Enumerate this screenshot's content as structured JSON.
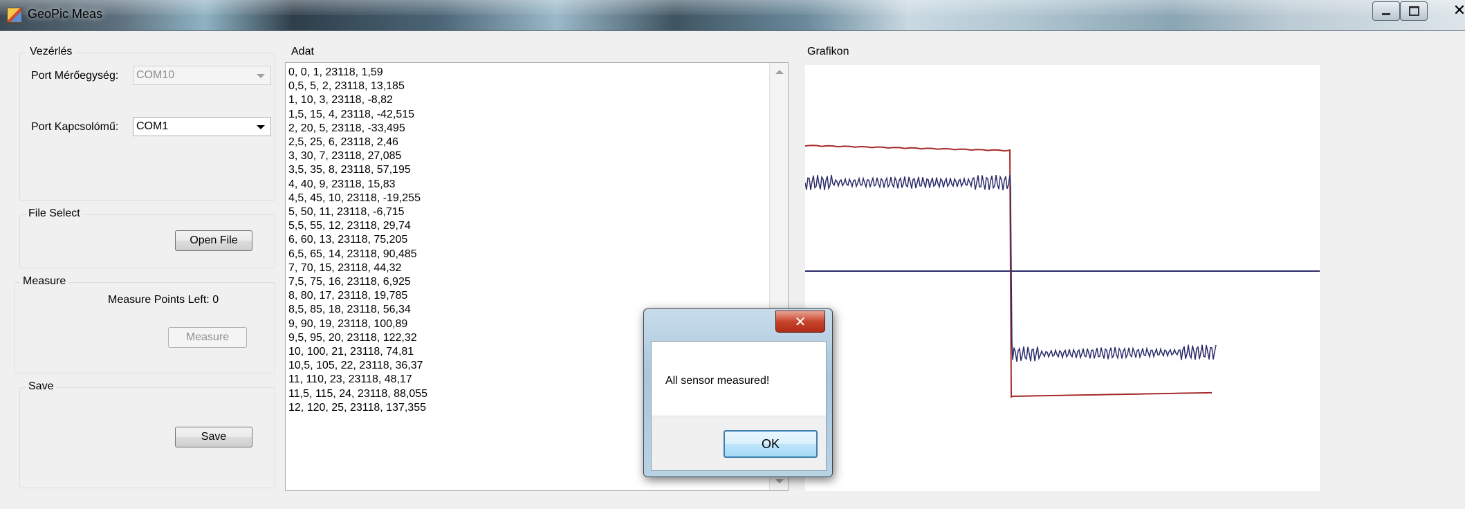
{
  "window": {
    "title": "GeoPic Meas"
  },
  "controls": {
    "title": "Vezérlés",
    "port_meter_label": "Port Mérőegység:",
    "port_meter_value": "COM10",
    "port_switch_label": "Port Kapcsolómű:",
    "port_switch_value": "COM1"
  },
  "file_select": {
    "title": "File Select",
    "open_label": "Open File"
  },
  "measure": {
    "title": "Measure",
    "points_left": "Measure Points Left: 0",
    "button_label": "Measure"
  },
  "save": {
    "title": "Save",
    "button_label": "Save"
  },
  "data": {
    "title": "Adat",
    "lines": [
      "0, 0, 1, 23118, 1,59",
      "0,5, 5, 2, 23118, 13,185",
      "1, 10, 3, 23118, -8,82",
      "1,5, 15, 4, 23118, -42,515",
      "2, 20, 5, 23118, -33,495",
      "2,5, 25, 6, 23118, 2,46",
      "3, 30, 7, 23118, 27,085",
      "3,5, 35, 8, 23118, 57,195",
      "4, 40, 9, 23118, 15,83",
      "4,5, 45, 10, 23118, -19,255",
      "5, 50, 11, 23118, -6,715",
      "5,5, 55, 12, 23118, 29,74",
      "6, 60, 13, 23118, 75,205",
      "6,5, 65, 14, 23118, 90,485",
      "7, 70, 15, 23118, 44,32",
      "7,5, 75, 16, 23118, 6,925",
      "8, 80, 17, 23118, 19,785",
      "8,5, 85, 18, 23118, 56,34",
      "9, 90, 19, 23118, 100,89",
      "9,5, 95, 20, 23118, 122,32",
      "10, 100, 21, 23118, 74,81",
      "10,5, 105, 22, 23118, 36,37",
      "11, 110, 23, 23118, 48,17",
      "11,5, 115, 24, 23118, 88,055",
      "12, 120, 25, 23118, 137,355"
    ]
  },
  "chart": {
    "title": "Grafikon",
    "colors": {
      "upper_series": "#a52a2a",
      "wave_series": "#2b2b6b",
      "baseline": "#2b2b6b"
    }
  },
  "dialog": {
    "message": "All sensor measured!",
    "ok_label": "OK",
    "close_glyph": "✕"
  },
  "icons": {
    "app": "app-icon",
    "minimize": "minimize-icon",
    "maximize": "maximize-icon",
    "close": "close-icon"
  }
}
